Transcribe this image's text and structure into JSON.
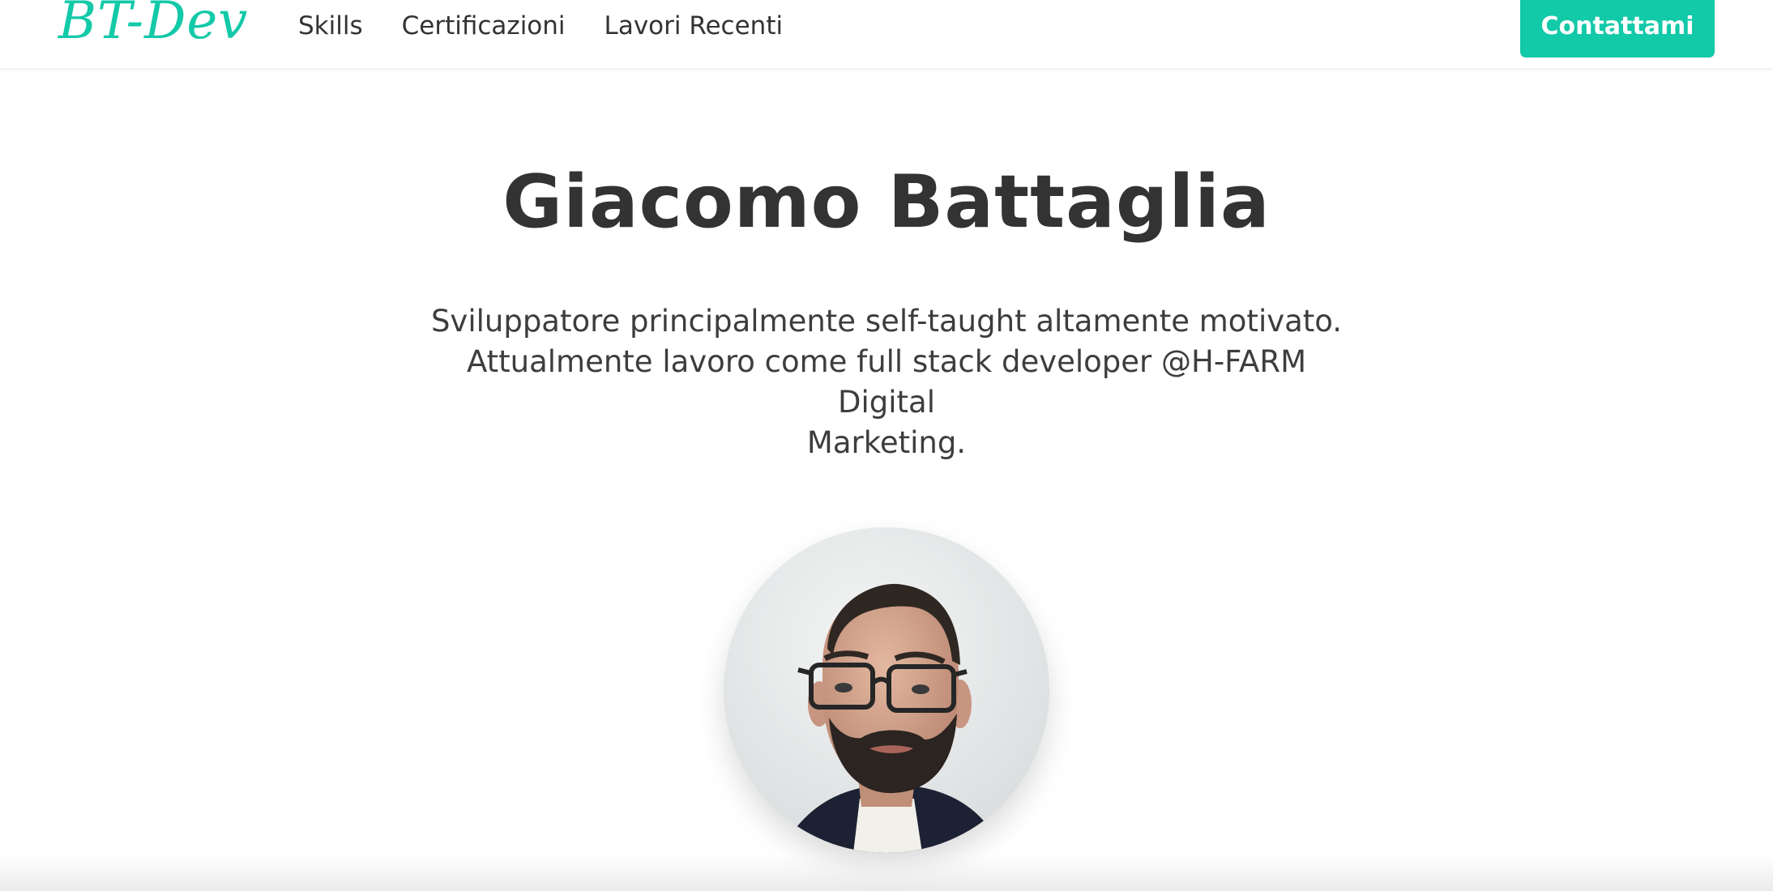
{
  "navbar": {
    "logo": "BT-Dev",
    "links": [
      {
        "label": "Skills"
      },
      {
        "label": "Certificazioni"
      },
      {
        "label": "Lavori Recenti"
      }
    ],
    "contact_label": "Contattami"
  },
  "hero": {
    "name": "Giacomo Battaglia",
    "bio_lines": [
      "Sviluppatore principalmente self-taught altamente motivato.",
      "Attualmente lavoro come full stack developer @H-FARM Digital",
      "Marketing."
    ],
    "avatar": "profile-photo"
  },
  "colors": {
    "accent": "#12c9a8",
    "text": "#333333",
    "background": "#ffffff"
  }
}
